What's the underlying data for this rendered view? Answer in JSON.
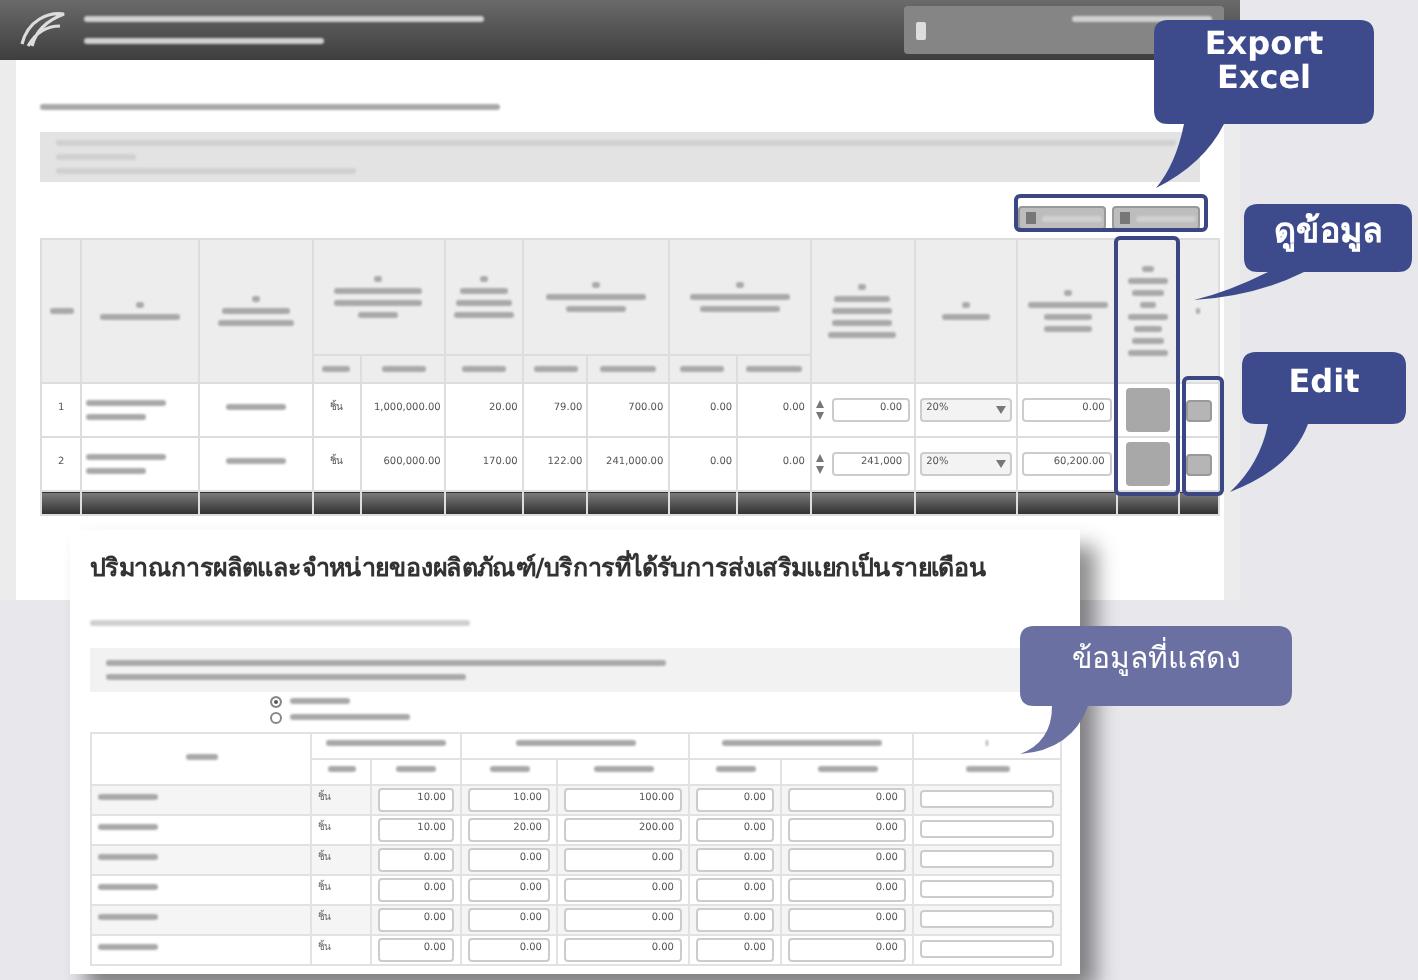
{
  "callouts": [
    {
      "kind": "primary",
      "text": "Export Excel"
    },
    {
      "kind": "primary",
      "text": "ดูข้อมูล"
    },
    {
      "kind": "primary",
      "text": "Edit"
    },
    {
      "kind": "secondary",
      "text": "ข้อมูลที่แสดง"
    }
  ],
  "main_table": {
    "rows": [
      {
        "number": "1",
        "unit": "ชิ้น",
        "cells": [
          "1,000,000.00",
          "20.00",
          "79.00",
          "700.00",
          "0.00",
          "0.00"
        ],
        "amount": "0.00",
        "rate": "20%",
        "result": "0.00"
      },
      {
        "number": "2",
        "unit": "ชิ้น",
        "cells": [
          "600,000.00",
          "170.00",
          "122.00",
          "241,000.00",
          "0.00",
          "0.00"
        ],
        "amount": "241,000",
        "rate": "20%",
        "result": "60,200.00"
      }
    ]
  },
  "detail_window": {
    "title": "ปริมาณการผลิตและจำหน่ายของผลิตภัณฑ์/บริการที่ได้รับการส่งเสริมแยกเป็นรายเดือน",
    "radios": [
      {
        "selected": true
      },
      {
        "selected": false
      }
    ],
    "rows": [
      {
        "unit": "ชิ้น",
        "values": [
          "10.00",
          "10.00",
          "100.00",
          "0.00",
          "0.00"
        ]
      },
      {
        "unit": "ชิ้น",
        "values": [
          "10.00",
          "20.00",
          "200.00",
          "0.00",
          "0.00"
        ]
      },
      {
        "unit": "ชิ้น",
        "values": [
          "0.00",
          "0.00",
          "0.00",
          "0.00",
          "0.00"
        ]
      },
      {
        "unit": "ชิ้น",
        "values": [
          "0.00",
          "0.00",
          "0.00",
          "0.00",
          "0.00"
        ]
      },
      {
        "unit": "ชิ้น",
        "values": [
          "0.00",
          "0.00",
          "0.00",
          "0.00",
          "0.00"
        ]
      },
      {
        "unit": "ชิ้น",
        "values": [
          "0.00",
          "0.00",
          "0.00",
          "0.00",
          "0.00"
        ]
      }
    ]
  }
}
